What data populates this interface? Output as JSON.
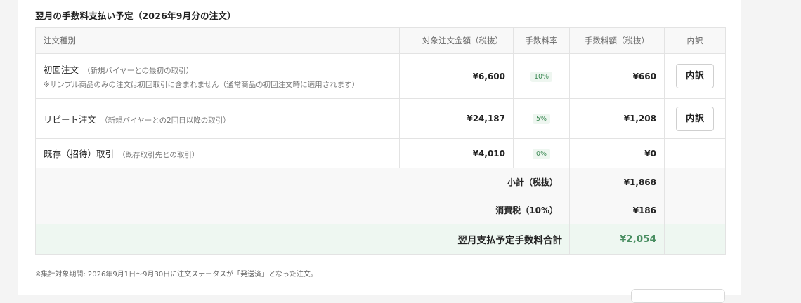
{
  "section": {
    "title": "翌月の手数料支払い予定（2026年9月分の注文）"
  },
  "table": {
    "headers": {
      "type": "注文種別",
      "amount": "対象注文金額（税抜）",
      "rate": "手数料率",
      "fee": "手数料額（税抜）",
      "detail": "内訳"
    },
    "rows": [
      {
        "type": "初回注文",
        "sub": "（新規バイヤーとの最初の取引）",
        "note": "※サンプル商品のみの注文は初回取引に含まれません（通常商品の初回注文時に適用されます）",
        "amount": "¥6,600",
        "rate": "10%",
        "fee": "¥660",
        "detail_label": "内訳"
      },
      {
        "type": "リピート注文",
        "sub": "（新規バイヤーとの2回目以降の取引）",
        "amount": "¥24,187",
        "rate": "5%",
        "fee": "¥1,208",
        "detail_label": "内訳"
      },
      {
        "type": "既存（招待）取引",
        "sub": "（既存取引先との取引）",
        "amount": "¥4,010",
        "rate": "0%",
        "fee": "¥0",
        "detail_label": "—"
      }
    ],
    "subtotal": {
      "label": "小計（税抜）",
      "value": "¥1,868"
    },
    "tax": {
      "label": "消費税（10%）",
      "value": "¥186"
    },
    "total": {
      "label": "翌月支払予定手数料合計",
      "value": "¥2,054"
    }
  },
  "footnote": "※集計対象期間: 2026年9月1日～9月30日に注文ステータスが「発送済」となった注文。",
  "colors": {
    "accent_green": "#4a8e62",
    "badge_bg": "#eef6f0",
    "total_row_bg": "#eef7f1"
  }
}
